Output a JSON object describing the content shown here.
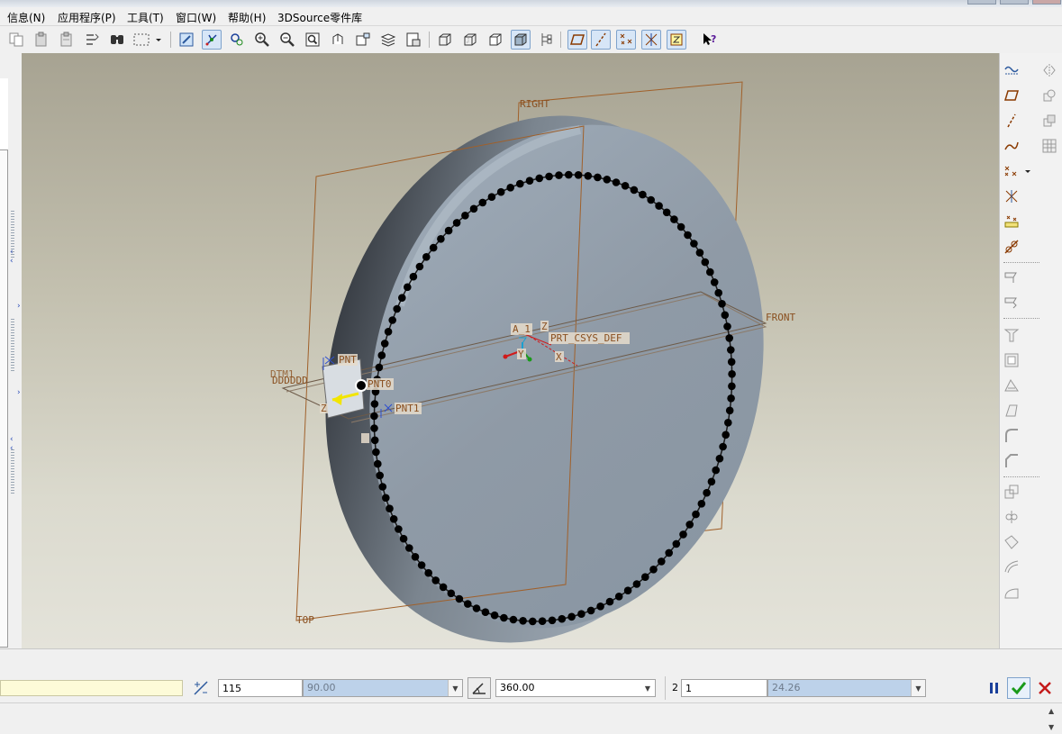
{
  "menu": {
    "items": [
      {
        "label": "信息(N)"
      },
      {
        "label": "应用程序(P)"
      },
      {
        "label": "工具(T)"
      },
      {
        "label": "窗口(W)"
      },
      {
        "label": "帮助(H)"
      },
      {
        "label": "3DSource零件库"
      }
    ]
  },
  "toolbar": {
    "icons": [
      "copy-icon",
      "paste-icon",
      "paste-special-icon",
      "regenerate-icon",
      "find-icon",
      "select-box-icon",
      "dropdown-icon",
      "redraw-icon",
      "spin-center-icon",
      "orient-mode-icon",
      "zoom-in-icon",
      "zoom-out-icon",
      "refit-icon",
      "reorient-icon",
      "saved-views-icon",
      "layers-icon",
      "view-manager-icon",
      "wireframe-icon",
      "hidden-line-icon",
      "no-hidden-icon",
      "shading-icon",
      "model-tree-icon",
      "datum-plane-display-icon",
      "datum-axis-display-icon",
      "point-display-icon",
      "csys-display-icon",
      "context-help-icon"
    ]
  },
  "viewport": {
    "labels": {
      "right": "RIGHT",
      "front": "FRONT",
      "top": "TOP",
      "axis": "A_1",
      "csys": "PRT_CSYS_DEF",
      "pnt0": "PNT0",
      "pnt1": "PNT1",
      "pnt_partial": "PNT",
      "dtm": "DDDDDD",
      "dtm_overlap": "DTM1",
      "x": "X",
      "y": "Y",
      "z": "Z"
    }
  },
  "right_panel": {
    "icons": [
      "sketched-curve-icon",
      "mirror-icon",
      "datum-plane-icon",
      "merge-icon",
      "datum-axis-icon",
      "intersect-icon",
      "datum-curve-icon",
      "pattern-icon",
      "datum-point-icon",
      "datum-csys-icon",
      "analysis-icon",
      "sketch-tool-icon",
      "extrude-icon",
      "revolve-icon",
      "hole-icon",
      "shell-icon",
      "rib-icon",
      "draft-icon",
      "round-icon",
      "chamfer-icon",
      "offset-icon",
      "thicken-icon",
      "solidify-icon",
      "boundary-blend-icon",
      "style-icon",
      "freeform-icon"
    ]
  },
  "dashboard": {
    "count_value": "115",
    "spacing_value": "90.00",
    "angle_value": "360.00",
    "second_label": "2",
    "second_count": "1",
    "second_spacing": "24.26"
  }
}
